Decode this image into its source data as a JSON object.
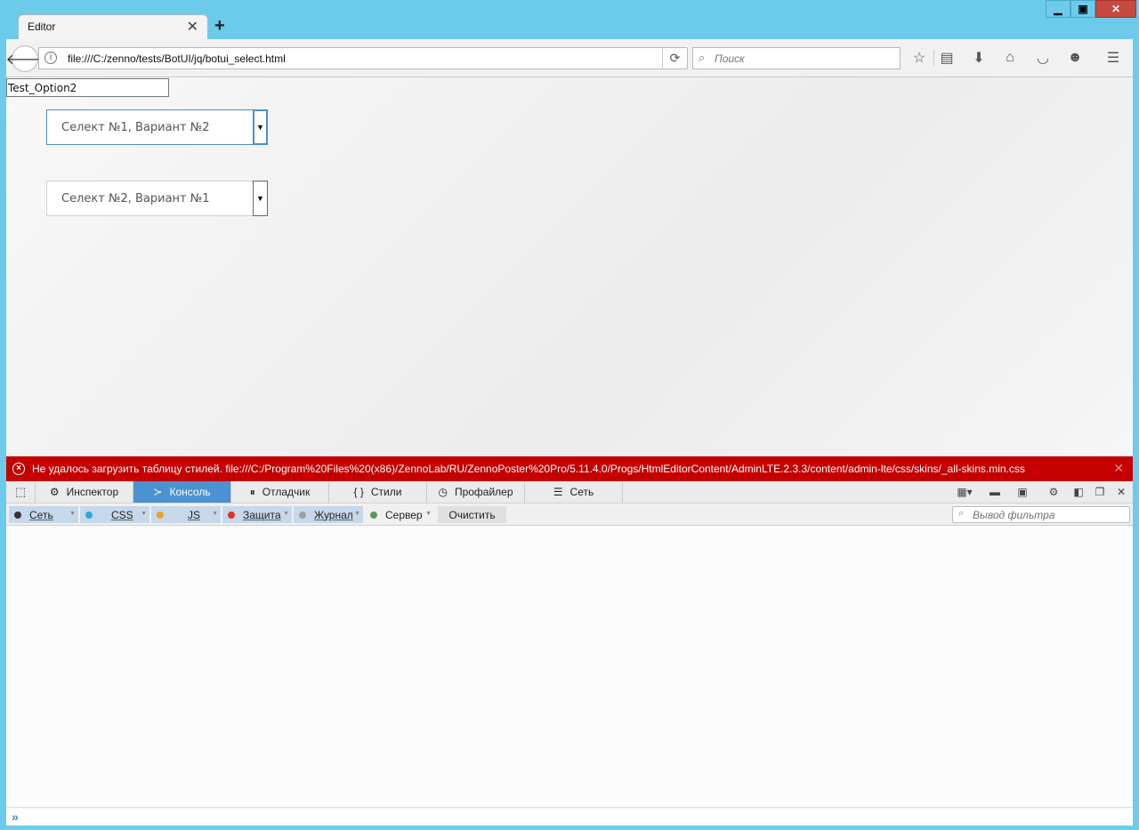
{
  "window": {
    "tab_title": "Editor",
    "tab_close": "✕",
    "new_tab": "+",
    "minimize": "▁",
    "maximize": "▣",
    "close": "✕"
  },
  "navbar": {
    "back": "🡐",
    "info": "i",
    "url": "file:///C:/zenno/tests/BotUI/jq/botui_select.html",
    "reload": "⟳",
    "search_placeholder": "Поиск",
    "icons": [
      "star-icon",
      "reading-list-icon",
      "download-icon",
      "home-icon",
      "pocket-icon",
      "smiley-icon",
      "menu-icon"
    ]
  },
  "page": {
    "test_input_value": "Test_Option2",
    "select1_value": "Селект №1, Вариант №2",
    "select2_value": "Селект №2, Вариант №1",
    "select_arrow": "▼"
  },
  "devtools": {
    "error_message": "Не удалось загрузить таблицу стилей. file:///C:/Program%20Files%20(x86)/ZennoLab/RU/ZennoPoster%20Pro/5.11.4.0/Progs/HtmlEditorContent/AdminLTE.2.3.3/content/admin-lte/css/skins/_all-skins.min.css",
    "error_icon": "×",
    "error_close": "✕",
    "tabs": [
      {
        "label": "Инспектор",
        "icon": "⚙"
      },
      {
        "label": "Консоль",
        "icon": "≻"
      },
      {
        "label": "Отладчик",
        "icon": "⏸"
      },
      {
        "label": "Стили",
        "icon": "{ }"
      },
      {
        "label": "Профайлер",
        "icon": "◷"
      },
      {
        "label": "Сеть",
        "icon": "☰"
      }
    ],
    "active_tab": "Консоль",
    "filters": [
      {
        "label": "Сеть",
        "color": "#333333"
      },
      {
        "label": "CSS",
        "color": "#2fa5e0"
      },
      {
        "label": "JS",
        "color": "#f0a020"
      },
      {
        "label": "Защита",
        "color": "#e03030"
      },
      {
        "label": "Журнал",
        "color": "#a0a0a0"
      },
      {
        "label": "Сервер",
        "color": "#5a9a5a"
      }
    ],
    "clear_label": "Очистить",
    "filter_placeholder": "Вывод фильтра",
    "prompt_icon": "»"
  }
}
